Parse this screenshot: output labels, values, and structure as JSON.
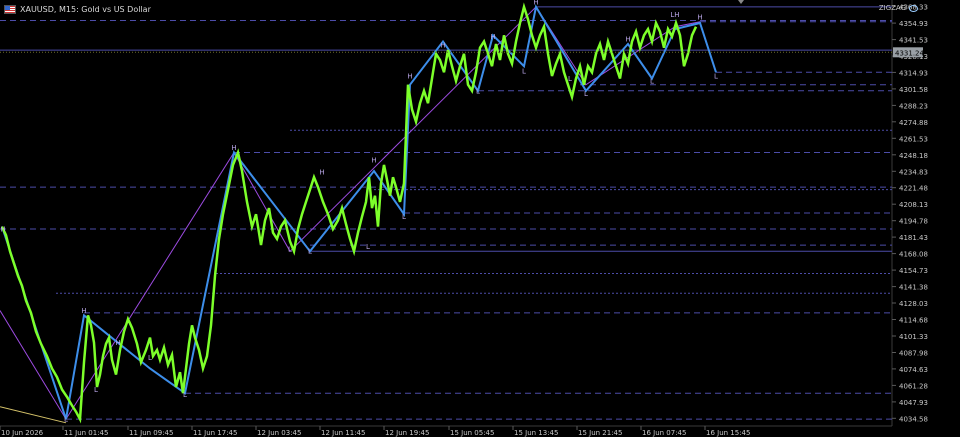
{
  "window": {
    "title": "XAUUSD, M15:  Gold vs US Dollar",
    "indicator_label": "ZIGZAG"
  },
  "colors": {
    "background": "#000000",
    "zigzag": "#7dff2a",
    "blue_line": "#3d8eea",
    "purple_line": "#9c4be0",
    "level_line": "#4c4ca8",
    "tick_text": "#c8c8c8",
    "price_tag": "#9aa0a6"
  },
  "chart_data": {
    "type": "line",
    "symbol": "XAUUSD",
    "timeframe": "M15",
    "y_tick_labels": [
      "4368.33",
      "4354.93",
      "4341.53",
      "4328.13",
      "4314.93",
      "4301.58",
      "4288.23",
      "4274.88",
      "4261.53",
      "4248.18",
      "4234.83",
      "4221.48",
      "4208.13",
      "4194.78",
      "4181.43",
      "4168.08",
      "4154.73",
      "4141.38",
      "4128.03",
      "4114.68",
      "4101.33",
      "4087.98",
      "4074.63",
      "4061.28",
      "4047.93",
      "4034.58"
    ],
    "x_tick_labels": [
      "10 Jun 2026",
      "11 Jun 01:45",
      "11 Jun 09:45",
      "11 Jun 17:45",
      "12 Jun 03:45",
      "12 Jun 11:45",
      "12 Jun 19:45",
      "15 Jun 05:45",
      "15 Jun 13:45",
      "15 Jun 21:45",
      "16 Jun 07:45",
      "16 Jun 15:45"
    ],
    "current_price": "4331.24",
    "ylim": [
      4030,
      4372
    ],
    "zigzag": {
      "name": "ZIGZAG",
      "x": [
        2,
        6,
        10,
        14,
        18,
        22,
        26,
        31,
        36,
        41,
        47,
        52,
        57,
        62,
        67,
        72,
        76,
        80,
        84,
        88,
        91,
        94,
        97,
        100,
        103,
        106,
        109,
        112,
        116,
        120,
        124,
        128,
        132,
        137,
        141,
        146,
        150,
        153,
        157,
        160,
        164,
        168,
        172,
        176,
        180,
        183,
        186,
        189,
        192,
        195,
        199,
        203,
        207,
        211,
        215,
        219,
        223,
        228,
        233,
        238,
        242,
        247,
        252,
        256,
        261,
        265,
        269,
        273,
        277,
        281,
        285,
        290,
        294,
        298,
        302,
        306,
        310,
        314,
        318,
        323,
        328,
        333,
        338,
        342,
        346,
        350,
        354,
        358,
        362,
        366,
        369,
        372,
        375,
        378,
        381,
        384,
        387,
        390,
        393,
        396,
        400,
        404,
        408,
        412,
        416,
        420,
        424,
        428,
        432,
        436,
        440,
        444,
        448,
        452,
        456,
        460,
        464,
        468,
        472,
        476,
        480,
        484,
        488,
        492,
        496,
        500,
        504,
        508,
        512,
        516,
        520,
        524,
        528,
        532,
        536,
        540,
        544,
        548,
        552,
        556,
        560,
        564,
        568,
        572,
        576,
        580,
        584,
        588,
        592,
        596,
        600,
        604,
        608,
        612,
        616,
        620,
        624,
        628,
        632,
        636,
        640,
        644,
        648,
        652,
        656,
        660,
        664,
        668,
        672,
        676,
        680,
        684,
        688,
        692,
        696,
        700,
        704,
        708,
        712,
        716,
        720,
        724,
        728,
        733
      ],
      "y": [
        4190,
        4183,
        4170,
        4160,
        4150,
        4142,
        4130,
        4120,
        4105,
        4095,
        4085,
        4075,
        4068,
        4058,
        4052,
        4045,
        4040,
        4034,
        4080,
        4118,
        4110,
        4096,
        4060,
        4070,
        4085,
        4095,
        4100,
        4082,
        4070,
        4090,
        4105,
        4115,
        4108,
        4095,
        4080,
        4090,
        4100,
        4085,
        4090,
        4082,
        4092,
        4078,
        4086,
        4060,
        4072,
        4055,
        4075,
        4095,
        4110,
        4100,
        4090,
        4075,
        4085,
        4110,
        4150,
        4180,
        4200,
        4220,
        4240,
        4250,
        4235,
        4210,
        4190,
        4200,
        4175,
        4195,
        4205,
        4185,
        4180,
        4190,
        4195,
        4178,
        4170,
        4188,
        4200,
        4210,
        4220,
        4230,
        4222,
        4210,
        4200,
        4188,
        4195,
        4205,
        4192,
        4180,
        4170,
        4185,
        4198,
        4210,
        4230,
        4205,
        4215,
        4190,
        4225,
        4240,
        4228,
        4215,
        4230,
        4222,
        4210,
        4225,
        4305,
        4285,
        4275,
        4290,
        4300,
        4290,
        4310,
        4330,
        4325,
        4315,
        4333,
        4320,
        4308,
        4320,
        4330,
        4305,
        4300,
        4315,
        4335,
        4340,
        4330,
        4320,
        4338,
        4325,
        4345,
        4330,
        4322,
        4340,
        4355,
        4368,
        4358,
        4345,
        4335,
        4345,
        4352,
        4330,
        4312,
        4322,
        4330,
        4315,
        4305,
        4295,
        4310,
        4320,
        4305,
        4320,
        4315,
        4330,
        4338,
        4325,
        4340,
        4330,
        4320,
        4310,
        4330,
        4322,
        4340,
        4348,
        4335,
        4345,
        4350,
        4340,
        4355,
        4348,
        4335,
        4350,
        4344,
        4355,
        4345,
        4320,
        4330,
        4345,
        4352
      ],
      "points_note": "x values are chart pixel columns of the M15 bars"
    },
    "swing_labels": [
      {
        "text": "H",
        "x": 3,
        "y": 4186
      },
      {
        "text": "L",
        "x": 66,
        "y": 4032
      },
      {
        "text": "H",
        "x": 84,
        "y": 4120
      },
      {
        "text": "L",
        "x": 96,
        "y": 4056
      },
      {
        "text": "H",
        "x": 118,
        "y": 4094
      },
      {
        "text": "L",
        "x": 150,
        "y": 4082
      },
      {
        "text": "L",
        "x": 185,
        "y": 4052
      },
      {
        "text": "H",
        "x": 234,
        "y": 4252
      },
      {
        "text": "L",
        "x": 290,
        "y": 4170
      },
      {
        "text": "L",
        "x": 310,
        "y": 4168
      },
      {
        "text": "H",
        "x": 322,
        "y": 4232
      },
      {
        "text": "L",
        "x": 368,
        "y": 4172
      },
      {
        "text": "H",
        "x": 374,
        "y": 4242
      },
      {
        "text": "L",
        "x": 404,
        "y": 4196
      },
      {
        "text": "H",
        "x": 410,
        "y": 4310
      },
      {
        "text": "H",
        "x": 443,
        "y": 4335
      },
      {
        "text": "L",
        "x": 478,
        "y": 4298
      },
      {
        "text": "H",
        "x": 493,
        "y": 4342
      },
      {
        "text": "L",
        "x": 524,
        "y": 4314
      },
      {
        "text": "H",
        "x": 536,
        "y": 4370
      },
      {
        "text": "L",
        "x": 570,
        "y": 4308
      },
      {
        "text": "L",
        "x": 586,
        "y": 4296
      },
      {
        "text": "H",
        "x": 628,
        "y": 4340
      },
      {
        "text": "L",
        "x": 652,
        "y": 4306
      },
      {
        "text": "LH",
        "x": 675,
        "y": 4360
      },
      {
        "text": "H",
        "x": 700,
        "y": 4358
      },
      {
        "text": "L",
        "x": 716,
        "y": 4310
      }
    ],
    "blue_swings": {
      "x": [
        2,
        66,
        84,
        150,
        185,
        234,
        310,
        374,
        404,
        410,
        443,
        478,
        493,
        524,
        536,
        586,
        628,
        652,
        675,
        700,
        716
      ],
      "y": [
        4190,
        4034,
        4118,
        4075,
        4055,
        4250,
        4170,
        4235,
        4200,
        4305,
        4340,
        4300,
        4345,
        4320,
        4368,
        4300,
        4338,
        4310,
        4350,
        4355,
        4315
      ]
    },
    "purple_swings": {
      "x": [
        0,
        66,
        234,
        290,
        536,
        586,
        675,
        700
      ],
      "y": [
        4122,
        4034,
        4250,
        4170,
        4368,
        4305,
        4352,
        4356
      ]
    },
    "yellow_swing": {
      "x": [
        0,
        66
      ],
      "y": [
        4044,
        4031
      ]
    },
    "levels": [
      {
        "y": 4368,
        "x0": 536,
        "style": "solid"
      },
      {
        "y": 4357,
        "x0": 0,
        "style": "dash"
      },
      {
        "y": 4356,
        "x0": 700,
        "style": "dash"
      },
      {
        "y": 4333,
        "x0": 0,
        "style": "solid"
      },
      {
        "y": 4315,
        "x0": 716,
        "style": "dash"
      },
      {
        "y": 4305,
        "x0": 580,
        "style": "dash"
      },
      {
        "y": 4300,
        "x0": 478,
        "style": "dash"
      },
      {
        "y": 4268,
        "x0": 290,
        "style": "dot"
      },
      {
        "y": 4250,
        "x0": 234,
        "style": "dash"
      },
      {
        "y": 4222,
        "x0": 0,
        "style": "dash"
      },
      {
        "y": 4220,
        "x0": 374,
        "style": "dot"
      },
      {
        "y": 4201,
        "x0": 404,
        "style": "dash"
      },
      {
        "y": 4188,
        "x0": 0,
        "style": "dash"
      },
      {
        "y": 4175,
        "x0": 310,
        "style": "dash"
      },
      {
        "y": 4170,
        "x0": 310,
        "style": "solid"
      },
      {
        "y": 4152,
        "x0": 216,
        "style": "dot"
      },
      {
        "y": 4136,
        "x0": 56,
        "style": "dot"
      },
      {
        "y": 4120,
        "x0": 84,
        "style": "dash"
      },
      {
        "y": 4055,
        "x0": 185,
        "style": "dash"
      },
      {
        "y": 4034,
        "x0": 66,
        "style": "dash"
      }
    ]
  }
}
